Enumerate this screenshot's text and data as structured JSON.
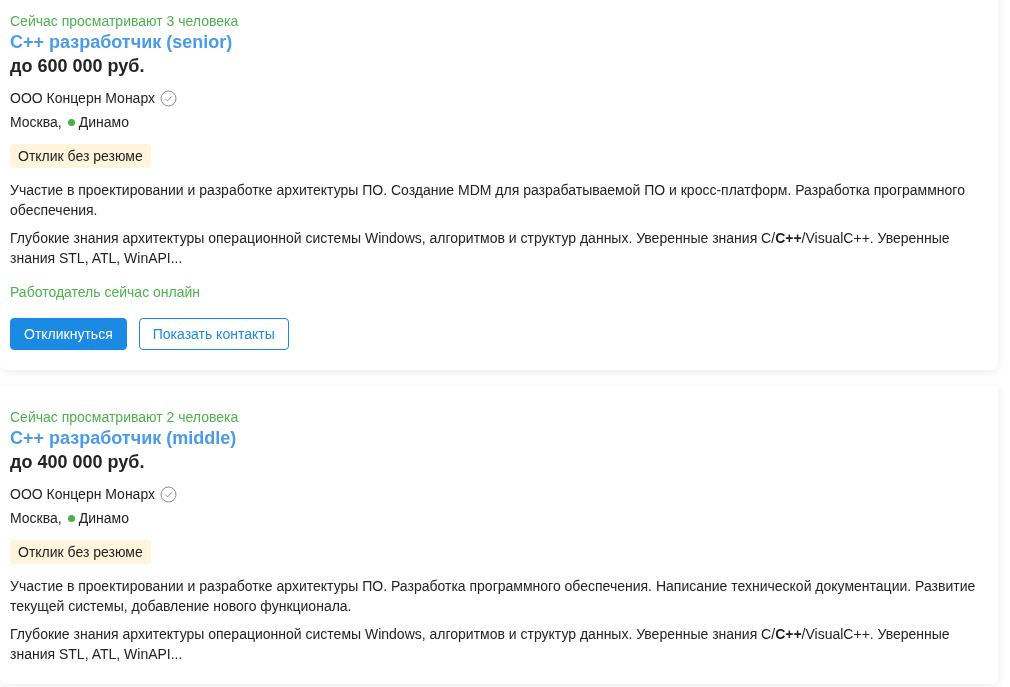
{
  "vacancies": [
    {
      "viewers": "Сейчас просматривают 3 человека",
      "title": "C++ разработчик (senior)",
      "salary": "до 600 000 руб.",
      "company": "ООО Концерн Монарх",
      "verified": true,
      "city": "Москва,",
      "metro": {
        "name": "Динамо",
        "color": "#4caf50"
      },
      "badge": "Отклик без резюме",
      "description": "Участие в проектировании и разработке архитектуры ПО. Создание MDM для разрабатываемой ПО и кросс-платформ. Разработка программного обеспечения.",
      "requirements": "Глубокие знания архитектуры операционной системы Windows, алгоритмов и структур данных. Уверенные знания C/**C++**/VisualC++. Уверенные знания STL, ATL, WinAPI...",
      "online": "Работодатель сейчас онлайн",
      "buttons": [
        {
          "kind": "primary",
          "label": "Откликнуться"
        },
        {
          "kind": "outline",
          "label": "Показать контакты"
        }
      ]
    },
    {
      "viewers": "Сейчас просматривают 2 человека",
      "title": "C++ разработчик (middle)",
      "salary": "до 400 000 руб.",
      "company": "ООО Концерн Монарх",
      "verified": true,
      "city": "Москва,",
      "metro": {
        "name": "Динамо",
        "color": "#4caf50"
      },
      "badge": "Отклик без резюме",
      "description": "Участие в проектировании и разработке архитектуры ПО. Разработка программного обеспечения. Написание технической документации. Развитие текущей системы, добавление нового функционала.",
      "requirements": "Глубокие знания архитектуры операционной системы Windows, алгоритмов и структур данных. Уверенные знания C/**C++**/VisualC++. Уверенные знания STL, ATL, WinAPI..."
    }
  ]
}
